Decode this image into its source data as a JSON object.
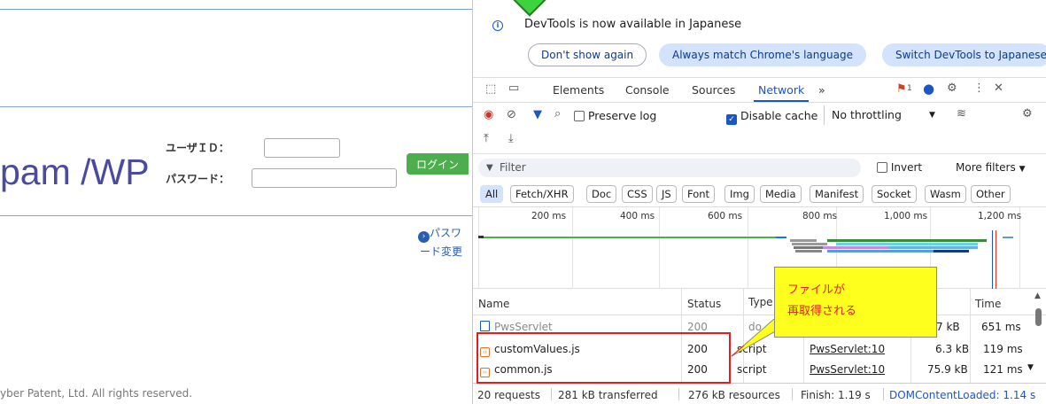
{
  "page": {
    "brand": "pam /WP",
    "user_id_label": "ユーザＩＤ：",
    "password_label": "パスワード：",
    "login_label": "ログイン",
    "password_link_1": "パスワ",
    "password_link_2": "ード変更",
    "copyright": "yber Patent, Ltd. All rights reserved."
  },
  "devtools": {
    "info_text": "DevTools is now available in Japanese",
    "dont_show": "Don't show again",
    "always_match": "Always match Chrome's language",
    "switch_lang": "Switch DevTools to Japanese",
    "tabs": [
      "Elements",
      "Console",
      "Sources",
      "Network"
    ],
    "more_tabs": "»",
    "issues_count": "1",
    "preserve_log": "Preserve log",
    "disable_cache": "Disable cache",
    "throttling": "No throttling",
    "filter_placeholder": "Filter",
    "invert": "Invert",
    "more_filters": "More filters",
    "filter_chips": [
      "All",
      "Fetch/XHR",
      "Doc",
      "CSS",
      "JS",
      "Font",
      "Img",
      "Media",
      "Manifest",
      "Socket",
      "Wasm",
      "Other"
    ],
    "timeline_ticks": [
      "200 ms",
      "400 ms",
      "600 ms",
      "800 ms",
      "1,000 ms",
      "1,200 ms"
    ],
    "columns": {
      "name": "Name",
      "status": "Status",
      "type": "Type",
      "time": "Time"
    },
    "rows": [
      {
        "name": "PwsServlet",
        "status": "200",
        "type": "do",
        "initiator": "",
        "size": "7 kB",
        "time": "651 ms"
      },
      {
        "name": "customValues.js",
        "status": "200",
        "type": "script",
        "initiator": "PwsServlet:10",
        "size": "6.3 kB",
        "time": "119 ms"
      },
      {
        "name": "common.js",
        "status": "200",
        "type": "script",
        "initiator": "PwsServlet:10",
        "size": "75.9 kB",
        "time": "121 ms"
      }
    ],
    "status_bar": {
      "requests": "20 requests",
      "transferred": "281 kB transferred",
      "resources": "276 kB resources",
      "finish": "Finish: 1.19 s",
      "dcl": "DOMContentLoaded: 1.14 s"
    }
  },
  "annotation": {
    "line1": "ファイルが",
    "line2": "再取得される"
  },
  "colors": {
    "accent": "#1a56c4",
    "annotation_red": "#e02020",
    "callout_yellow": "#ffff1e",
    "login_green": "#4cae4c"
  }
}
